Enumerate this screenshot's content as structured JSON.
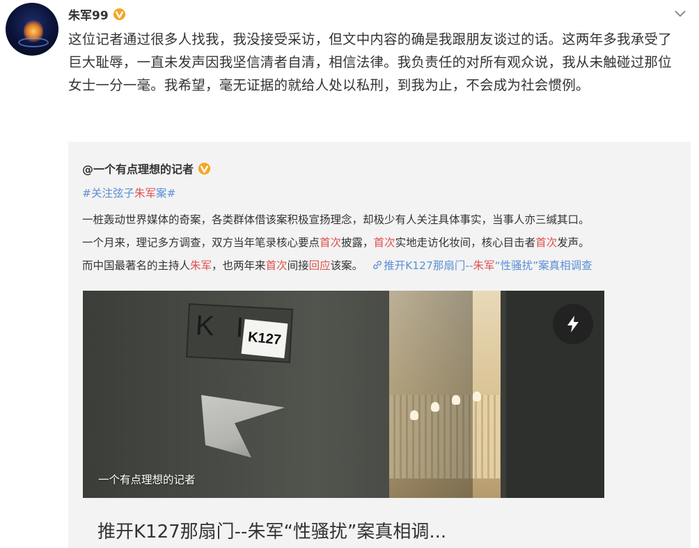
{
  "user": {
    "name": "朱军99"
  },
  "post": {
    "text": "这位记者通过很多人找我，我没接受采访，但文中内容的确是我跟朋友谈过的话。这两年多我承受了巨大耻辱，一直未发声因我坚信清者自清，相信法律。我负责任的对所有观众说，我从未触碰过那位女士一分一毫。我希望，毫无证据的就给人处以私刑，到我为止，不会成为社会惯例。"
  },
  "repost": {
    "author": "@一个有点理想的记者",
    "topic": {
      "prefix": "#关注弦子",
      "highlight": "朱军",
      "suffix": "案#"
    },
    "body": {
      "line1": "一桩轰动世界媒体的奇案，各类群体借该案积极宣扬理念，却极少有人关注具体事实，当事人亦三缄其口。",
      "line2_a": "一个月来，理记多方调查，双方当年笔录核心要点",
      "line2_b": "首次",
      "line2_c": "披露，",
      "line2_d": "首次",
      "line2_e": "实地走访化妆间，核心目击者",
      "line2_f": "首次",
      "line2_g": "发声。",
      "line3_a": "而中国最著名的主持人",
      "line3_b": "朱军",
      "line3_c": "，也两年来",
      "line3_d": "首次",
      "line3_e": "间接",
      "line3_f": "回应",
      "line3_g": "该案。",
      "link_a": "推开K127那扇门--",
      "link_b": "朱军",
      "link_c": "“性骚扰”案真相调查"
    },
    "media": {
      "plate_text": "K I",
      "plate_label": "K127",
      "caption": "一个有点理想的记者"
    },
    "card_title": "推开K127那扇门--朱军“性骚扰”案真相调..."
  },
  "colors": {
    "highlight": "#e05050",
    "link": "#5b8fd6",
    "verified": "#f5a623"
  },
  "icons": {
    "verified": "verified-v-icon",
    "more": "chevron-down-icon",
    "link": "link-icon",
    "flash": "lightning-icon"
  }
}
